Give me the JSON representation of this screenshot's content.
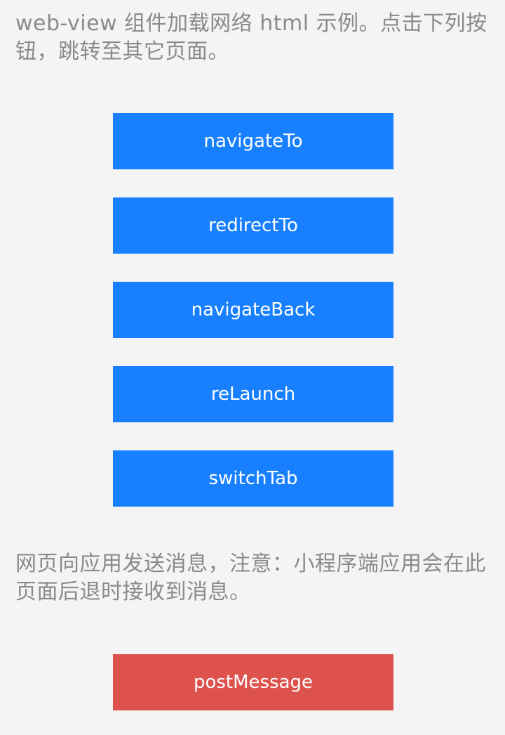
{
  "intro_text": "web-view 组件加载网络 html 示例。点击下列按钮，跳转至其它页面。",
  "nav_buttons": [
    {
      "label": "navigateTo"
    },
    {
      "label": "redirectTo"
    },
    {
      "label": "navigateBack"
    },
    {
      "label": "reLaunch"
    },
    {
      "label": "switchTab"
    }
  ],
  "message_text": "网页向应用发送消息，注意：小程序端应用会在此页面后退时接收到消息。",
  "post_button": {
    "label": "postMessage"
  },
  "colors": {
    "background": "#f4f4f4",
    "text_gray": "#8a8a8a",
    "primary_blue": "#1880ff",
    "warn_red": "#dd524d"
  }
}
